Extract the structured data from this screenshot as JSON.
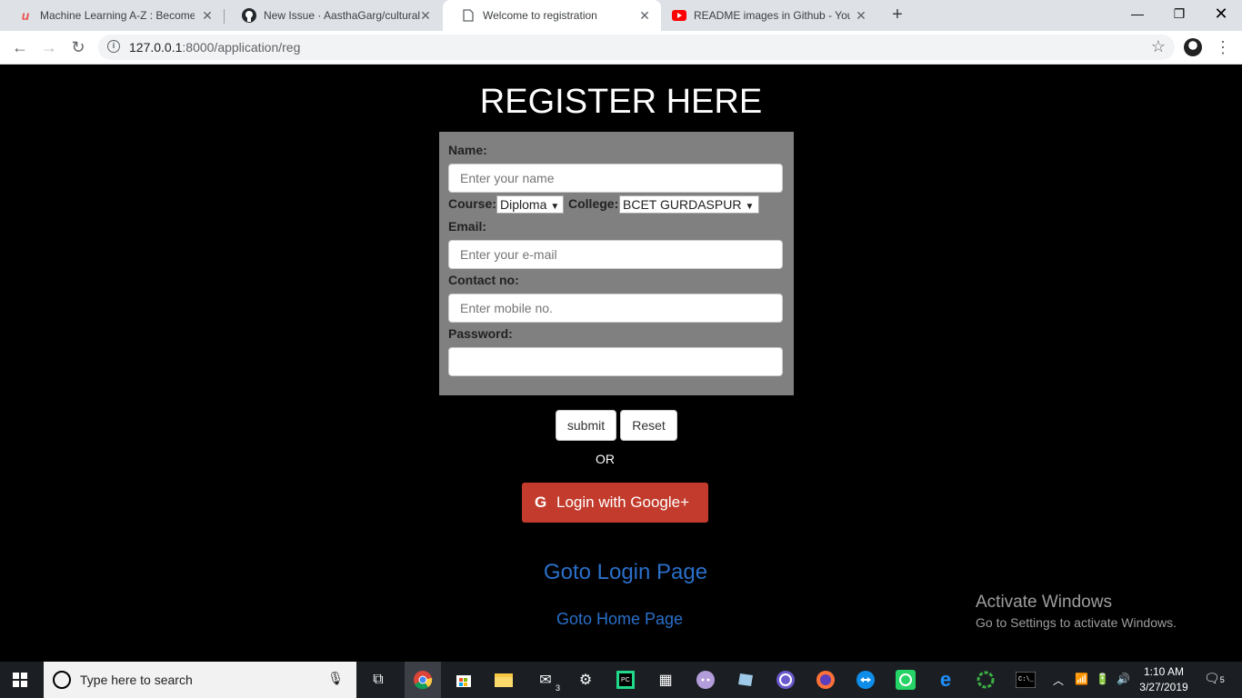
{
  "browser": {
    "tabs": [
      {
        "title": "Machine Learning A-Z : Become I",
        "icon": "udemy-icon"
      },
      {
        "title": "New Issue · AasthaGarg/cultural-",
        "icon": "github-icon"
      },
      {
        "title": "Welcome to registration",
        "icon": "page-icon"
      },
      {
        "title": "README images in Github - YouT",
        "icon": "youtube-icon"
      }
    ],
    "url_host": "127.0.0.1",
    "url_path": ":8000/application/reg"
  },
  "page": {
    "heading": "REGISTER HERE",
    "form": {
      "name_label": "Name:",
      "name_placeholder": "Enter your name",
      "course_label": "Course:",
      "course_value": "Diploma",
      "college_label": "College:",
      "college_value": "BCET GURDASPUR",
      "email_label": "Email:",
      "email_placeholder": "Enter your e-mail",
      "contact_label": "Contact no:",
      "contact_placeholder": "Enter mobile no.",
      "password_label": "Password:"
    },
    "submit_label": "submit",
    "reset_label": "Reset",
    "or_text": "OR",
    "google_label": "Login with Google+",
    "login_link": "Goto Login Page",
    "home_link": "Goto Home Page"
  },
  "watermark": {
    "line1": "Activate Windows",
    "line2": "Go to Settings to activate Windows."
  },
  "taskbar": {
    "search_placeholder": "Type here to search",
    "time": "1:10 AM",
    "date": "3/27/2019",
    "notification_count": "5",
    "mail_badge": "3"
  }
}
